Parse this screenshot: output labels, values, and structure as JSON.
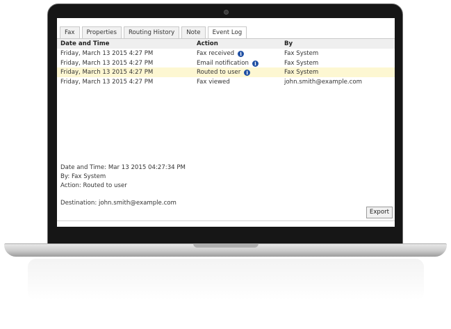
{
  "tabs": [
    "Fax",
    "Properties",
    "Routing History",
    "Note",
    "Event Log"
  ],
  "active_tab": "Event Log",
  "table": {
    "headers": [
      "Date and Time",
      "Action",
      "By"
    ],
    "rows": [
      {
        "date": "Friday, March 13 2015 4:27 PM",
        "action": "Fax received",
        "by": "Fax System",
        "info": true,
        "selected": false
      },
      {
        "date": "Friday, March 13 2015 4:27 PM",
        "action": "Email notification",
        "by": "Fax System",
        "info": true,
        "selected": false
      },
      {
        "date": "Friday, March 13 2015 4:27 PM",
        "action": "Routed to user",
        "by": "Fax System",
        "info": true,
        "selected": true
      },
      {
        "date": "Friday, March 13 2015 4:27 PM",
        "action": "Fax viewed",
        "by": "john.smith@example.com",
        "info": false,
        "selected": false
      }
    ]
  },
  "details": {
    "datetime": "Date and Time: Mar 13 2015 04:27:34 PM",
    "by": "By: Fax System",
    "action": "Action: Routed to user",
    "destination": "Destination: john.smith@example.com"
  },
  "export_label": "Export",
  "colors": {
    "selected_row": "#fdf7d2",
    "info_icon": "#1f4fa3",
    "header_bg": "#efefef"
  }
}
